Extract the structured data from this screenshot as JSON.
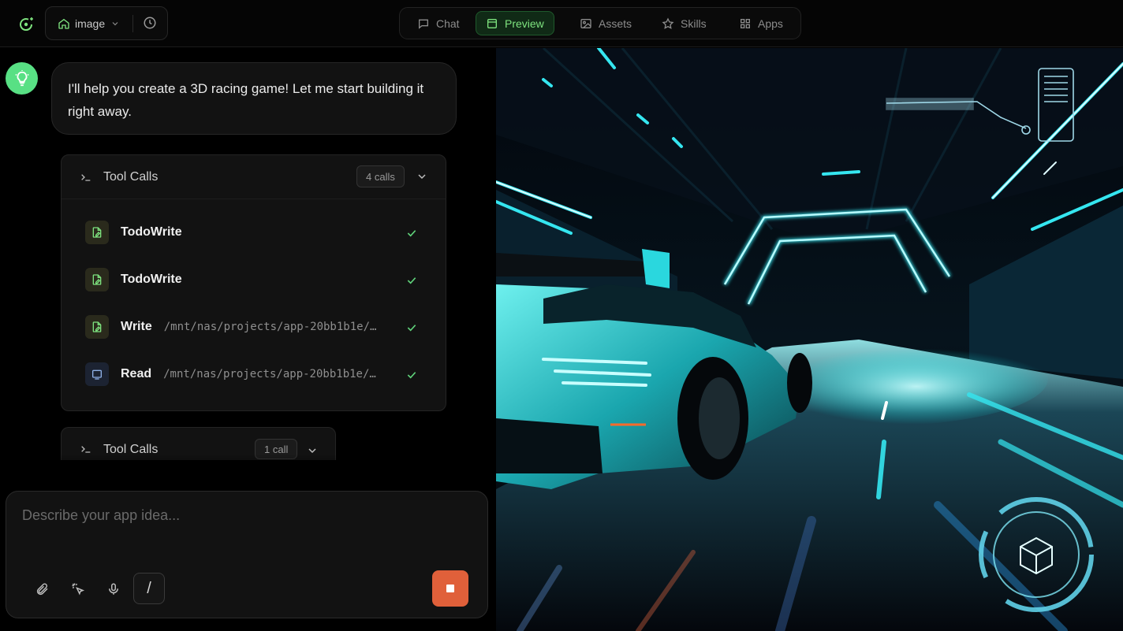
{
  "topbar": {
    "project_name": "image",
    "tabs": [
      {
        "label": "Chat",
        "icon": "chat-bubble-icon",
        "active": false
      },
      {
        "label": "Preview",
        "icon": "preview-window-icon",
        "active": true
      },
      {
        "label": "Assets",
        "icon": "image-icon",
        "active": false
      },
      {
        "label": "Skills",
        "icon": "star-icon",
        "active": false
      },
      {
        "label": "Apps",
        "icon": "grid-icon",
        "active": false
      }
    ]
  },
  "chat": {
    "assistant_message": "I'll help you create a 3D racing game! Let me start building it right away.",
    "tool_calls_1": {
      "title": "Tool Calls",
      "count_label": "4 calls",
      "items": [
        {
          "name": "TodoWrite",
          "path": "",
          "icon": "file-edit-icon",
          "status": "done"
        },
        {
          "name": "TodoWrite",
          "path": "",
          "icon": "file-edit-icon",
          "status": "done"
        },
        {
          "name": "Write",
          "path": "/mnt/nas/projects/app-20bb1b1e/…",
          "icon": "file-edit-icon",
          "status": "done"
        },
        {
          "name": "Read",
          "path": "/mnt/nas/projects/app-20bb1b1e/…",
          "icon": "file-read-icon",
          "status": "done"
        }
      ]
    },
    "tool_calls_2": {
      "title": "Tool Calls",
      "count_label": "1 call"
    },
    "composer": {
      "placeholder": "Describe your app idea...",
      "slash_label": "/"
    }
  },
  "colors": {
    "accent_green": "#7ee37f",
    "avatar_green": "#58e084",
    "stop_orange": "#e0603a",
    "neon_cyan": "#35e6f0"
  }
}
